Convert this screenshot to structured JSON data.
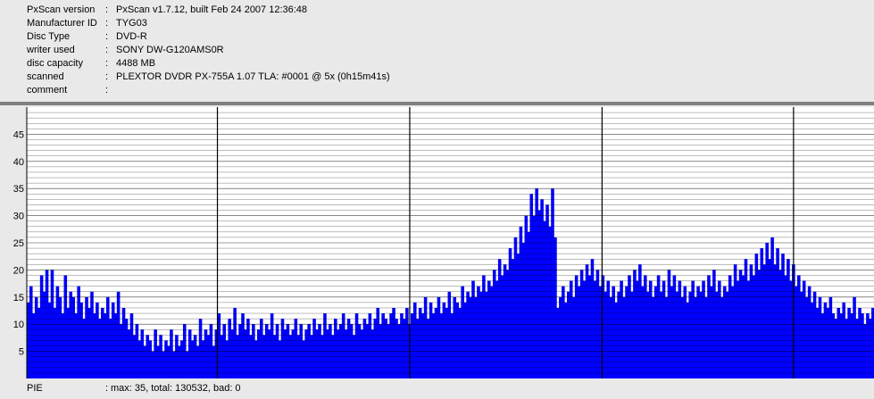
{
  "info": {
    "rows": [
      {
        "label": "PxScan version",
        "value": "PxScan v1.7.12, built Feb 24 2007 12:36:48"
      },
      {
        "label": "Manufacturer ID",
        "value": "TYG03"
      },
      {
        "label": "Disc Type",
        "value": "DVD-R"
      },
      {
        "label": "writer used",
        "value": "SONY DW-G120AMS0R"
      },
      {
        "label": "disc capacity",
        "value": "4488 MB"
      },
      {
        "label": "scanned",
        "value": "PLEXTOR DVDR PX-755A 1.07 TLA: #0001 @ 5x (0h15m41s)"
      },
      {
        "label": "comment",
        "value": ""
      }
    ],
    "separator": ":"
  },
  "footer": {
    "label": "PIE",
    "separator": ":",
    "summary": "max: 35, total: 130532, bad: 0"
  },
  "colors": {
    "bars": "#0000ff",
    "background": "#ffffff",
    "gridline": "#000000",
    "divider": "#808080"
  },
  "chart_data": {
    "type": "bar",
    "title": "",
    "xlabel": "",
    "ylabel": "",
    "ylim": [
      0,
      50
    ],
    "yticks": [
      5,
      10,
      15,
      20,
      25,
      30,
      35,
      40,
      45
    ],
    "grid": true,
    "series": [
      {
        "values": [
          14,
          17,
          12,
          15,
          13,
          19,
          16,
          20,
          14,
          20,
          13,
          17,
          15,
          12,
          19,
          13,
          16,
          15,
          12,
          17,
          14,
          11,
          15,
          13,
          16,
          12,
          14,
          11,
          13,
          12,
          15,
          11,
          14,
          12,
          16,
          10,
          13,
          11,
          9,
          12,
          8,
          10,
          7,
          9,
          6,
          8,
          7,
          5,
          9,
          6,
          8,
          5,
          7,
          6,
          9,
          5,
          8,
          6,
          7,
          10,
          5,
          9,
          7,
          8,
          6,
          11,
          7,
          9,
          8,
          10,
          6,
          9,
          12,
          8,
          10,
          7,
          11,
          9,
          13,
          8,
          10,
          12,
          9,
          11,
          8,
          10,
          7,
          9,
          11,
          8,
          10,
          9,
          12,
          8,
          10,
          7,
          11,
          9,
          10,
          8,
          9,
          11,
          8,
          10,
          7,
          9,
          10,
          8,
          11,
          9,
          10,
          8,
          12,
          9,
          10,
          8,
          11,
          9,
          10,
          12,
          9,
          11,
          10,
          8,
          12,
          10,
          9,
          11,
          10,
          12,
          9,
          11,
          13,
          10,
          12,
          11,
          10,
          12,
          13,
          11,
          10,
          12,
          11,
          13,
          10,
          12,
          14,
          11,
          13,
          12,
          15,
          11,
          14,
          12,
          13,
          15,
          12,
          14,
          13,
          16,
          12,
          15,
          14,
          13,
          17,
          14,
          16,
          15,
          18,
          15,
          17,
          16,
          19,
          16,
          18,
          17,
          20,
          18,
          22,
          19,
          21,
          20,
          24,
          22,
          26,
          23,
          28,
          25,
          30,
          27,
          34,
          30,
          35,
          31,
          33,
          29,
          32,
          28,
          35,
          26,
          13,
          15,
          17,
          14,
          16,
          18,
          15,
          19,
          17,
          20,
          18,
          21,
          19,
          22,
          18,
          20,
          17,
          19,
          16,
          18,
          15,
          17,
          14,
          16,
          18,
          15,
          17,
          19,
          16,
          20,
          18,
          21,
          17,
          19,
          16,
          18,
          15,
          17,
          19,
          16,
          18,
          15,
          20,
          17,
          19,
          16,
          18,
          15,
          17,
          14,
          16,
          18,
          15,
          17,
          16,
          18,
          15,
          19,
          17,
          20,
          16,
          18,
          15,
          17,
          16,
          19,
          17,
          21,
          18,
          20,
          19,
          22,
          18,
          21,
          19,
          23,
          20,
          24,
          21,
          25,
          22,
          26,
          21,
          24,
          20,
          23,
          19,
          22,
          18,
          21,
          17,
          19,
          16,
          18,
          15,
          17,
          14,
          16,
          13,
          15,
          12,
          14,
          13,
          15,
          12,
          11,
          13,
          12,
          14,
          11,
          13,
          12,
          15,
          11,
          13,
          12,
          10,
          12,
          11,
          13
        ]
      }
    ]
  }
}
